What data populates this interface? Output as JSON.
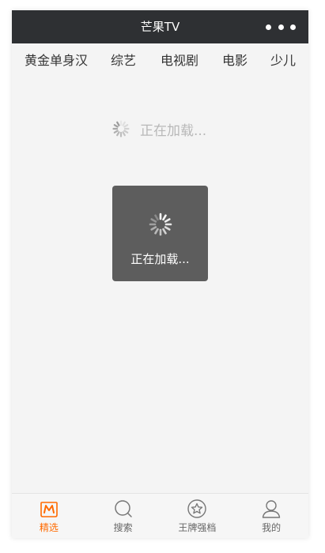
{
  "window": {
    "title": "芒果TV",
    "more_icon": "ellipsis-icon"
  },
  "category_tabs": [
    {
      "label": "黄金单身汉"
    },
    {
      "label": "综艺"
    },
    {
      "label": "电视剧"
    },
    {
      "label": "电影"
    },
    {
      "label": "少儿"
    }
  ],
  "content": {
    "loading_text": "正在加载..."
  },
  "toast": {
    "message": "正在加载..."
  },
  "tabbar": {
    "items": [
      {
        "label": "精选",
        "icon": "mango-logo-icon",
        "active": true
      },
      {
        "label": "搜索",
        "icon": "search-icon",
        "active": false
      },
      {
        "label": "王牌强档",
        "icon": "star-icon",
        "active": false
      },
      {
        "label": "我的",
        "icon": "user-icon",
        "active": false
      }
    ]
  },
  "colors": {
    "titlebar_bg": "#2e3033",
    "page_bg": "#f4f4f4",
    "active_accent": "#ff6a00",
    "inactive_text": "#666666"
  }
}
